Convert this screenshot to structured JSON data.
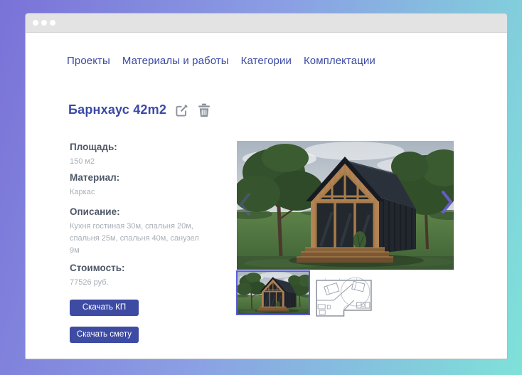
{
  "window": {
    "controls": [
      "close",
      "minimize",
      "maximize"
    ]
  },
  "nav": {
    "items": [
      {
        "label": "Проекты"
      },
      {
        "label": "Материалы и работы"
      },
      {
        "label": "Категории"
      },
      {
        "label": "Комплектации"
      }
    ]
  },
  "project": {
    "title": "Барнхаус 42m2",
    "actions": [
      {
        "icon": "edit-icon"
      },
      {
        "icon": "trash-icon"
      }
    ],
    "fields": [
      {
        "label": "Площадь:",
        "value": "150 м2"
      },
      {
        "label": "Материал:",
        "value": "Каркас"
      },
      {
        "label": "Описание:",
        "value": "Кухня гостиная 30м, спальня 20м, спальня 25м, спальня 40м, санузел 9м"
      },
      {
        "label": "Стоимость:",
        "value": "77526 руб."
      }
    ],
    "buttons": [
      {
        "label": "Скачать КП"
      },
      {
        "label": "Скачать смету"
      }
    ]
  },
  "gallery": {
    "main_image": "barnhouse-exterior-photo",
    "arrows": [
      "prev",
      "next"
    ],
    "thumbnails": [
      {
        "name": "barnhouse-exterior-photo",
        "selected": true
      },
      {
        "name": "floor-plan-drawing",
        "selected": false
      }
    ]
  },
  "colors": {
    "accent_button": "#3d4ba3",
    "nav_link": "#3b4aa5",
    "field_label": "#4e5866",
    "field_value": "#a9afb8",
    "icon_gray": "#8b919b",
    "thumb_selected_border": "#5a5ed4",
    "background_gradient": [
      "#7a72d8",
      "#8b9fe4",
      "#7ee2d9"
    ]
  }
}
